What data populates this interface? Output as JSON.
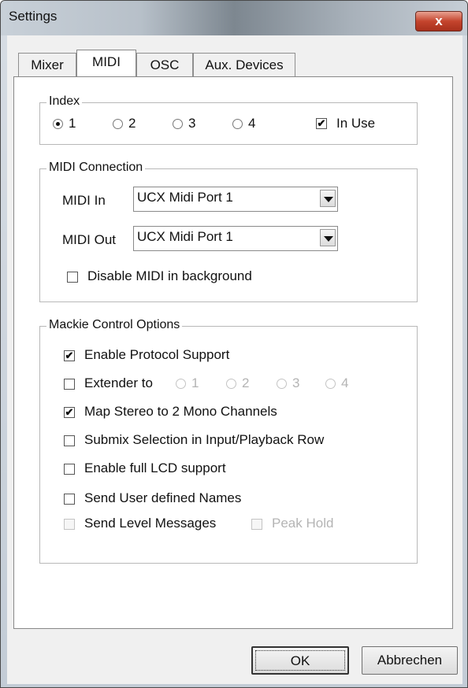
{
  "window": {
    "title": "Settings",
    "close_label": "x"
  },
  "tabs": [
    {
      "label": "Mixer"
    },
    {
      "label": "MIDI"
    },
    {
      "label": "OSC"
    },
    {
      "label": "Aux. Devices"
    }
  ],
  "index_group": {
    "legend": "Index",
    "options": [
      "1",
      "2",
      "3",
      "4"
    ],
    "selected": "1",
    "in_use_label": "In Use",
    "in_use_checked": true
  },
  "midi_connection": {
    "legend": "MIDI Connection",
    "midi_in_label": "MIDI In",
    "midi_in_value": "UCX Midi Port 1",
    "midi_out_label": "MIDI Out",
    "midi_out_value": "UCX Midi Port 1",
    "disable_bg_label": "Disable MIDI in background",
    "disable_bg_checked": false
  },
  "mackie": {
    "legend": "Mackie Control Options",
    "enable_protocol_label": "Enable Protocol Support",
    "enable_protocol_checked": true,
    "extender_label": "Extender to",
    "extender_options": [
      "1",
      "2",
      "3",
      "4"
    ],
    "map_stereo_label": "Map Stereo to 2 Mono Channels",
    "map_stereo_checked": true,
    "submix_label": "Submix Selection in Input/Playback Row",
    "lcd_label": "Enable full LCD support",
    "user_names_label": "Send User defined Names",
    "level_messages_label": "Send Level Messages",
    "peak_hold_label": "Peak Hold"
  },
  "buttons": {
    "ok_label": "OK",
    "cancel_label": "Abbrechen"
  }
}
